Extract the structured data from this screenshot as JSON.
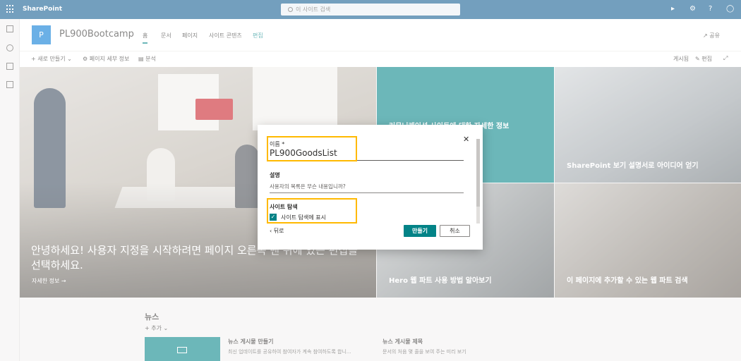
{
  "suite": {
    "brand": "SharePoint",
    "search_placeholder": "이 사이트 검색"
  },
  "site": {
    "logo_letter": "P",
    "title": "PL900Bootcamp",
    "nav": [
      "홈",
      "문서",
      "페이지",
      "사이트 콘텐츠",
      "편집"
    ],
    "share_label": "공유"
  },
  "command_bar": {
    "new_label": "새로 만들기",
    "page_details_label": "페이지 세부 정보",
    "analytics_label": "분석",
    "publish_label": "게시됨",
    "edit_label": "편집"
  },
  "hero": {
    "main_title": "안녕하세요! 사용자 지정을 시작하려면 페이지 오른쪽 맨 위에 있는 편집을 선택하세요.",
    "main_link": "자세한 정보 →",
    "tile1": "커뮤니케이션 사이트에 대한 자세한 정보",
    "tile2": "SharePoint 보기 설명서로 아이디어 얻기",
    "tile3": "Hero 웹 파트 사용 방법 알아보기",
    "tile4": "이 페이지에 추가할 수 있는 웹 파트 검색"
  },
  "news": {
    "title": "뉴스",
    "add_label": "+ 추가",
    "item1_title": "뉴스 게시물 만들기",
    "item1_desc": "최신 업데이트를 공유하여 참여자가 계속 참여하도록 합니...",
    "item2_title": "뉴스 게시물 제목",
    "item2_desc": "문서의 처음 몇 줄을 보여 주는 미리 보기"
  },
  "dialog": {
    "name_label": "이름 *",
    "name_value": "PL900GoodsList",
    "desc_label": "설명",
    "desc_placeholder": "사용자의 목록은 무슨 내용입니까?",
    "nav_section_label": "사이트 탐색",
    "nav_checkbox_label": "사이트 탐색에 표시",
    "nav_checked": true,
    "back_label": "뒤로",
    "create_label": "만들기",
    "cancel_label": "취소"
  },
  "colors": {
    "suite_bar": "#0f5a8f",
    "accent_teal": "#038387",
    "highlight": "#ffb900"
  }
}
